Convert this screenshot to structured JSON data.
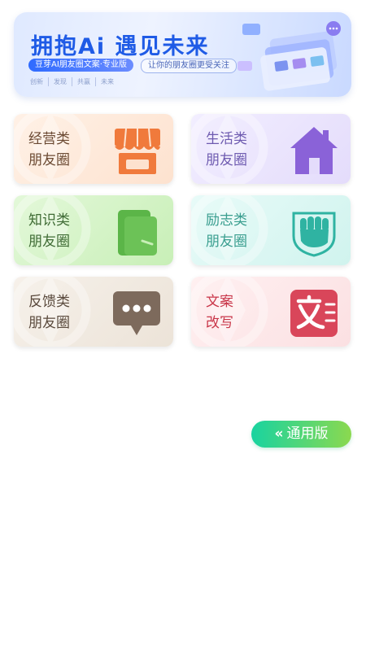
{
  "banner": {
    "title": "拥抱Ai 遇见未来",
    "pill": "豆芽AI朋友圈文案·专业版",
    "subtitle": "让你的朋友圈更受关注",
    "tags": [
      "创新",
      "发现",
      "共赢",
      "未来"
    ]
  },
  "cards": [
    {
      "line1": "经营类",
      "line2": "朋友圈",
      "icon": "shop-icon",
      "color": "#f07a3c"
    },
    {
      "line1": "生活类",
      "line2": "朋友圈",
      "icon": "home-icon",
      "color": "#8a62d8"
    },
    {
      "line1": "知识类",
      "line2": "朋友圈",
      "icon": "book-icon",
      "color": "#5bb548"
    },
    {
      "line1": "励志类",
      "line2": "朋友圈",
      "icon": "fist-icon",
      "color": "#2fb3a2"
    },
    {
      "line1": "反馈类",
      "line2": "朋友圈",
      "icon": "chat-bubble-icon",
      "color": "#7d6a5c"
    },
    {
      "line1": "文案",
      "line2": "改写",
      "icon": "text-icon",
      "color": "#d9465a"
    }
  ],
  "version_button": {
    "chevron": "«",
    "label": "通用版"
  }
}
